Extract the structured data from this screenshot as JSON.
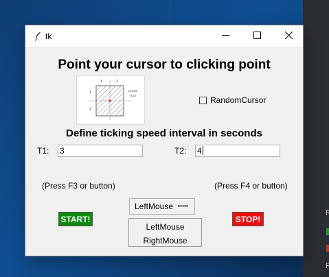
{
  "window": {
    "title": "tk",
    "heading": "Point your cursor to clicking point",
    "diagram_text": {
      "x1": "X",
      "x2": "X",
      "y1": "Y",
      "y2": "Y",
      "cursor": "Cursor",
      "coords": "(x,y)"
    },
    "random_cursor_label": "RandomCursor",
    "speed_heading": "Define ticking speed interval in seconds",
    "t1_label": "T1:",
    "t1_value": "3",
    "t2_label": "T2:",
    "t2_value": "4",
    "press_left": "(Press F3 or button)",
    "start_label": "START!",
    "mouse_button_selected": "LeftMouse",
    "mouse_button_options": [
      "LeftMouse",
      "RightMouse"
    ],
    "press_right": "(Press F4 or button)",
    "stop_label": "STOP!"
  },
  "colors": {
    "start": "#0f8a0f",
    "stop": "#ee0f0f",
    "window_bg": "#f0f0f0",
    "desktop": "#123e73"
  },
  "icons": [
    "feather-icon",
    "minimize-icon",
    "maximize-icon",
    "close-icon",
    "checkbox-icon",
    "dropdown-indicator-icon"
  ]
}
